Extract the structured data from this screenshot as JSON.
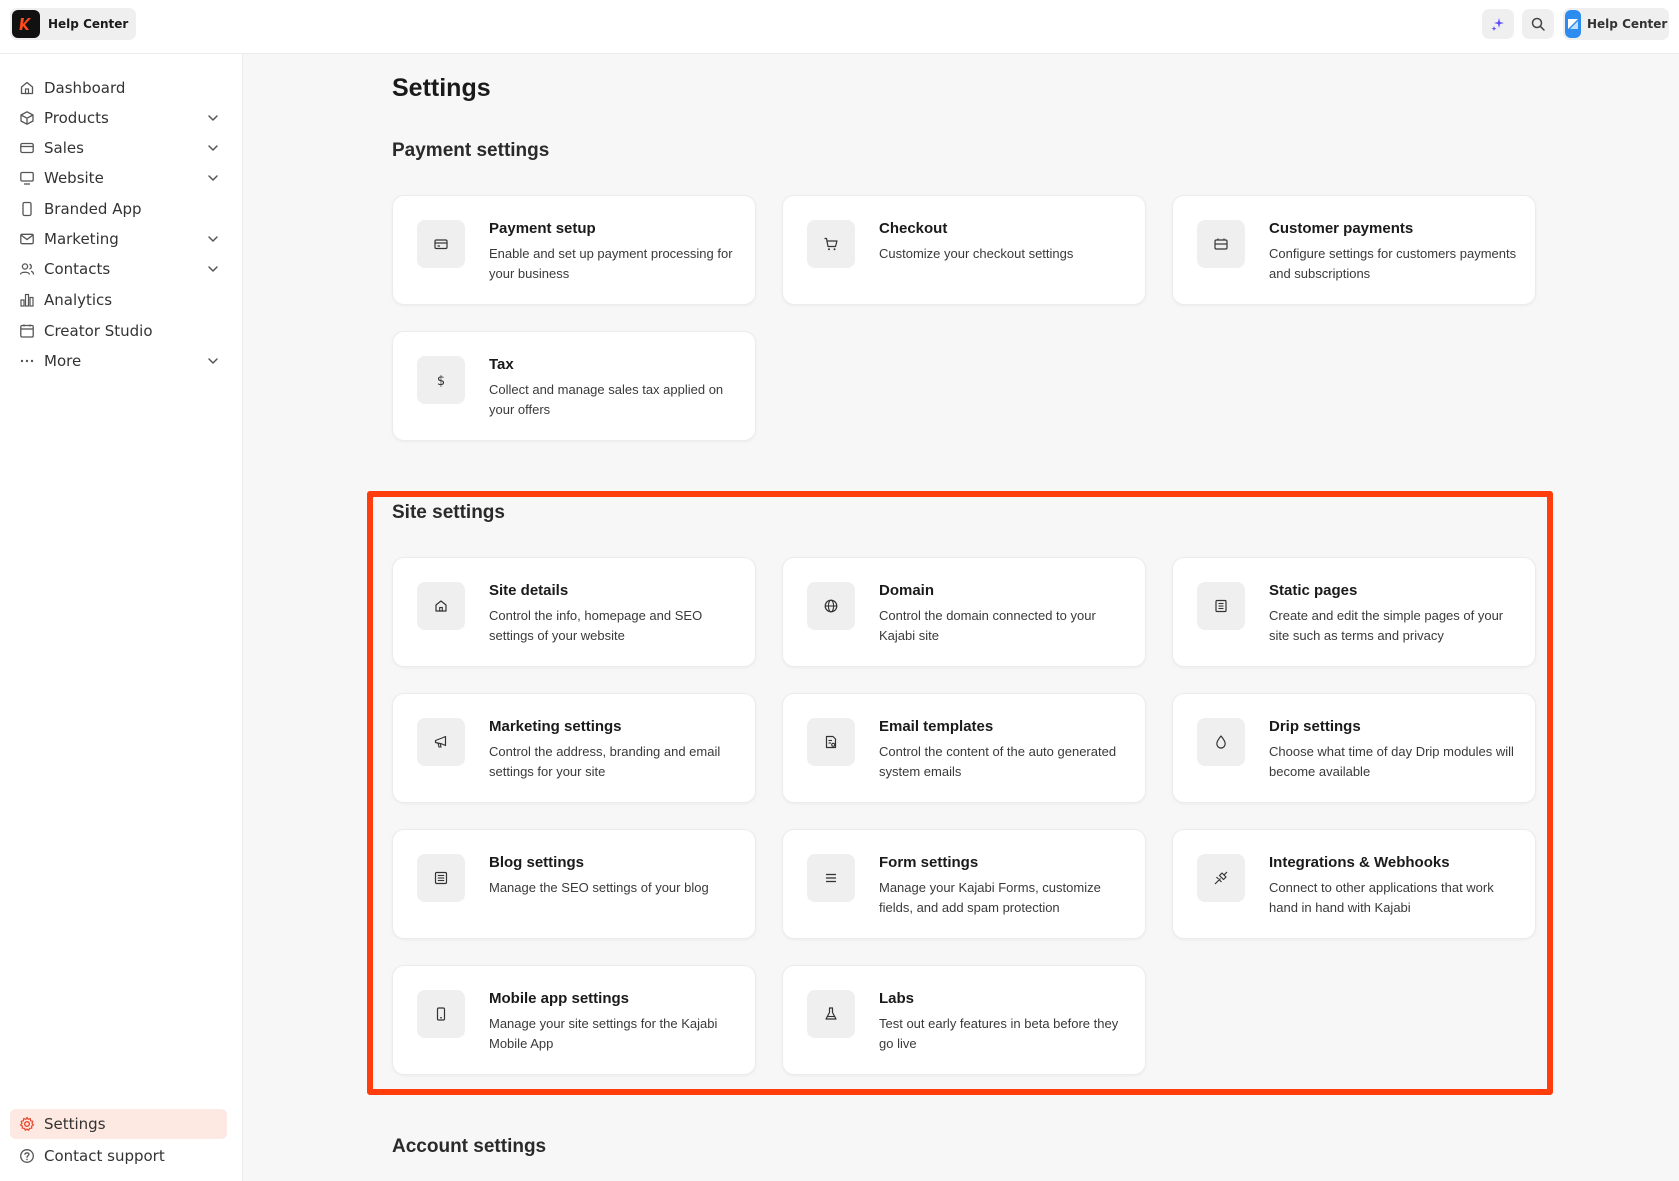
{
  "topbar": {
    "brand_label": "Help Center",
    "help_label": "Help Center",
    "ai_icon": "sparkle-icon",
    "search_icon": "search-icon",
    "colors": {
      "brand_logo": "#111111",
      "help_logo": "#2d8cf0",
      "ai_accent": "#5b4bff"
    }
  },
  "sidebar": {
    "items": [
      {
        "label": "Dashboard",
        "icon": "home-icon",
        "expandable": false
      },
      {
        "label": "Products",
        "icon": "box-icon",
        "expandable": true
      },
      {
        "label": "Sales",
        "icon": "card-icon",
        "expandable": true
      },
      {
        "label": "Website",
        "icon": "monitor-icon",
        "expandable": true
      },
      {
        "label": "Branded App",
        "icon": "phone-icon",
        "expandable": false
      },
      {
        "label": "Marketing",
        "icon": "mail-icon",
        "expandable": true
      },
      {
        "label": "Contacts",
        "icon": "users-icon",
        "expandable": true
      },
      {
        "label": "Analytics",
        "icon": "bar-chart-icon",
        "expandable": false
      },
      {
        "label": "Creator Studio",
        "icon": "calendar-icon",
        "expandable": false
      },
      {
        "label": "More",
        "icon": "dots-icon",
        "expandable": true
      }
    ],
    "footer": [
      {
        "label": "Settings",
        "icon": "gear-icon",
        "active": true
      },
      {
        "label": "Contact support",
        "icon": "help-circle-icon",
        "active": false
      }
    ],
    "active_color": "#fde8e2",
    "active_icon_color": "#e8462a"
  },
  "main": {
    "title": "Settings",
    "payment": {
      "title": "Payment settings",
      "cards": [
        {
          "title": "Payment setup",
          "desc": "Enable and set up payment processing for your business",
          "icon": "credit-card-icon"
        },
        {
          "title": "Checkout",
          "desc": "Customize your checkout settings",
          "icon": "cart-icon"
        },
        {
          "title": "Customer payments",
          "desc": "Configure settings for customers payments and subscriptions",
          "icon": "wallet-icon"
        },
        {
          "title": "Tax",
          "desc": "Collect and manage sales tax applied on your offers",
          "icon": "dollar-icon"
        }
      ]
    },
    "site": {
      "title": "Site settings",
      "cards": [
        {
          "title": "Site details",
          "desc": "Control the info, homepage and SEO settings of your website",
          "icon": "home-icon"
        },
        {
          "title": "Domain",
          "desc": "Control the domain connected to your Kajabi site",
          "icon": "globe-icon"
        },
        {
          "title": "Static pages",
          "desc": "Create and edit the simple pages of your site such as terms and privacy",
          "icon": "document-icon"
        },
        {
          "title": "Marketing settings",
          "desc": "Control the address, branding and email settings for your site",
          "icon": "megaphone-icon"
        },
        {
          "title": "Email templates",
          "desc": "Control the content of the auto generated system emails",
          "icon": "email-template-icon"
        },
        {
          "title": "Drip settings",
          "desc": "Choose what time of day Drip modules will become available",
          "icon": "droplet-icon"
        },
        {
          "title": "Blog settings",
          "desc": "Manage the SEO settings of your blog",
          "icon": "blog-icon"
        },
        {
          "title": "Form settings",
          "desc": "Manage your Kajabi Forms, customize fields, and add spam protection",
          "icon": "list-icon"
        },
        {
          "title": "Integrations & Webhooks",
          "desc": "Connect to other applications that work hand in hand with Kajabi",
          "icon": "plug-icon"
        },
        {
          "title": "Mobile app settings",
          "desc": "Manage your site settings for the Kajabi Mobile App",
          "icon": "mobile-icon"
        },
        {
          "title": "Labs",
          "desc": "Test out early features in beta before they go live",
          "icon": "flask-icon"
        }
      ]
    },
    "account": {
      "title": "Account settings"
    },
    "highlight_color": "#ff3d0d"
  }
}
